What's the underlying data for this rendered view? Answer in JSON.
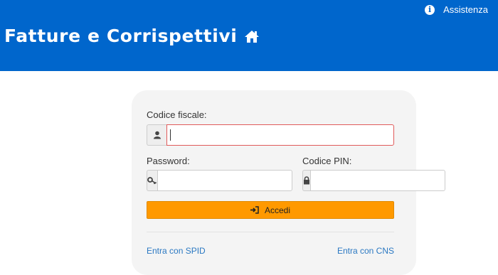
{
  "header": {
    "title": "Fatture e Corrispettivi",
    "help_label": "Assistenza",
    "background_color": "#0066cc",
    "icons": {
      "help": "info-icon",
      "home": "home-icon"
    }
  },
  "login": {
    "codice_fiscale": {
      "label": "Codice fiscale:",
      "value": "",
      "icon": "user-icon"
    },
    "password": {
      "label": "Password:",
      "value": "",
      "icon": "key-icon"
    },
    "pin": {
      "label": "Codice PIN:",
      "value": "",
      "icon": "lock-icon"
    },
    "submit_label": "Accedi",
    "submit_icon": "sign-in-icon",
    "submit_color": "#ff9900",
    "spid_link": "Entra con SPID",
    "cns_link": "Entra con CNS"
  }
}
